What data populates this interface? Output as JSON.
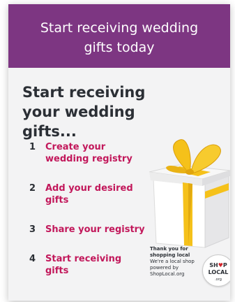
{
  "banner": {
    "title": "Start receiving wedding gifts today"
  },
  "heading": "Start receiving your wedding gifts...",
  "steps": [
    {
      "num": "1",
      "label": "Create your wedding registry"
    },
    {
      "num": "2",
      "label": "Add your desired gifts"
    },
    {
      "num": "3",
      "label": "Share your registry"
    },
    {
      "num": "4",
      "label": "Start receiving gifts"
    }
  ],
  "thanks": {
    "line1": "Thank you for shopping local",
    "line2": "We're a local shop powered by ShopLocal.org"
  },
  "badge": {
    "top": "SH",
    "heart": "♥",
    "p": "P",
    "bottom": "LOCAL",
    "org": ".org"
  },
  "colors": {
    "banner": "#7d3682",
    "accent": "#c2185b",
    "ribbon": "#f5c11a",
    "text": "#2b2f35"
  },
  "icons": {
    "gift": "gift-box-illustration",
    "badge": "shop-local-logo"
  }
}
